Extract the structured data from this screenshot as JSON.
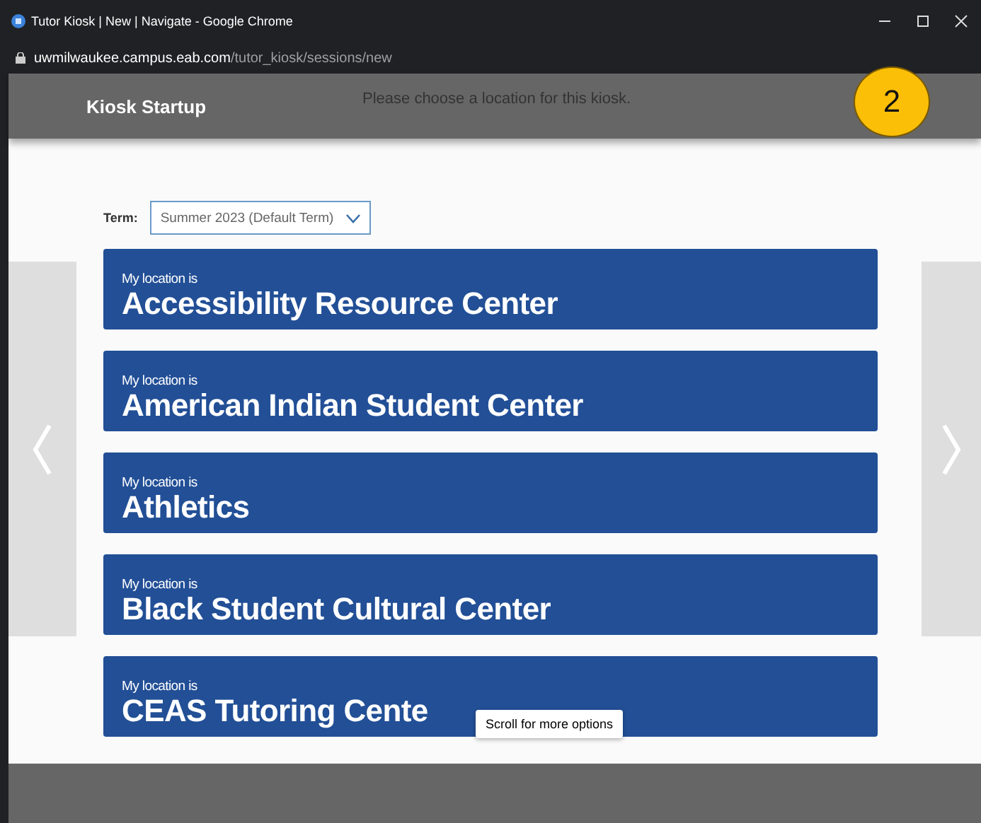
{
  "window": {
    "title": "Tutor Kiosk | New | Navigate - Google Chrome",
    "url_host": "uwmilwaukee.campus.eab.com",
    "url_path": "/tutor_kiosk/sessions/new"
  },
  "header": {
    "title": "Kiosk Startup",
    "message": "Please choose a location for this kiosk."
  },
  "badge": "2",
  "term": {
    "label": "Term:",
    "value": "Summer 2023 (Default Term)"
  },
  "locations": [
    {
      "prefix": "My location is",
      "name": "Accessibility Resource Center"
    },
    {
      "prefix": "My location is",
      "name": "American Indian Student Center"
    },
    {
      "prefix": "My location is",
      "name": "Athletics"
    },
    {
      "prefix": "My location is",
      "name": "Black Student Cultural Center"
    },
    {
      "prefix": "My location is",
      "name": "CEAS Tutoring Cente"
    }
  ],
  "tooltip": "Scroll for more options"
}
